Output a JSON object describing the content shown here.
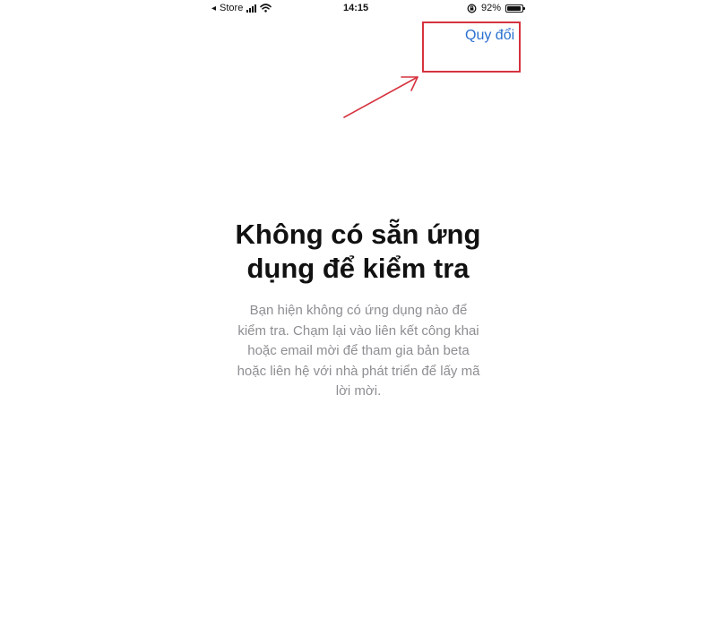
{
  "status_bar": {
    "carrier": "Store",
    "time": "14:15",
    "battery": "92%",
    "battery_level": 0.92,
    "icons": [
      "back-arrow-icon",
      "signal-icon",
      "wifi-icon",
      "orientation-lock-icon",
      "battery-icon"
    ]
  },
  "nav": {
    "redeem_label": "Quy đổi"
  },
  "empty_state": {
    "title_line1": "Không có sẵn ứng",
    "title_line2": "dụng để kiểm tra",
    "description_lines": [
      "Bạn hiện không có ứng dụng nào để",
      "kiểm tra. Chạm lại vào liên kết công khai",
      "hoặc email mời để tham gia bản beta",
      "hoặc liên hệ với nhà phát triển để lấy mã",
      "lời mời."
    ]
  },
  "colors": {
    "accent": "#2a6fcf",
    "annotation": "#d6333f",
    "title": "#111111",
    "secondary_text": "#8e8e93"
  }
}
